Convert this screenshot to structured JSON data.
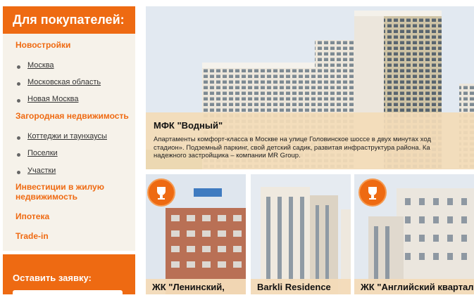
{
  "sidebar": {
    "title": "Для покупателей:",
    "categories": [
      {
        "label": "Новостройки"
      },
      {
        "label": "Загородная недвижимость"
      },
      {
        "label": "Инвестиции в жилую недвижимость"
      },
      {
        "label": "Ипотека"
      },
      {
        "label": "Trade-in"
      }
    ],
    "novostroyki_items": [
      "Москва",
      "Московская область",
      "Новая Москва"
    ],
    "zagorod_items": [
      "Коттеджи и таунхаусы",
      "Поселки",
      "Участки"
    ],
    "request_label": "Оставить заявку:"
  },
  "hero": {
    "title": "МФК \"Водный\"",
    "desc_lines": [
      "Апартаменты комфорт-класса в Москве на улице Головинское шоссе в двух минутах ход",
      "стадион». Подземный паркинг, свой детский садик, развитая инфраструктура района. Ка",
      "надежного застройщика – компании MR Group."
    ]
  },
  "cards": [
    {
      "title": "ЖК \"Ленинский,"
    },
    {
      "title": "Barkli Residence"
    },
    {
      "title": "ЖК \"Английский квартал"
    }
  ],
  "colors": {
    "accent": "#ee6a12",
    "panel": "#f6f2ea",
    "overlay": "#f3dbb8"
  }
}
